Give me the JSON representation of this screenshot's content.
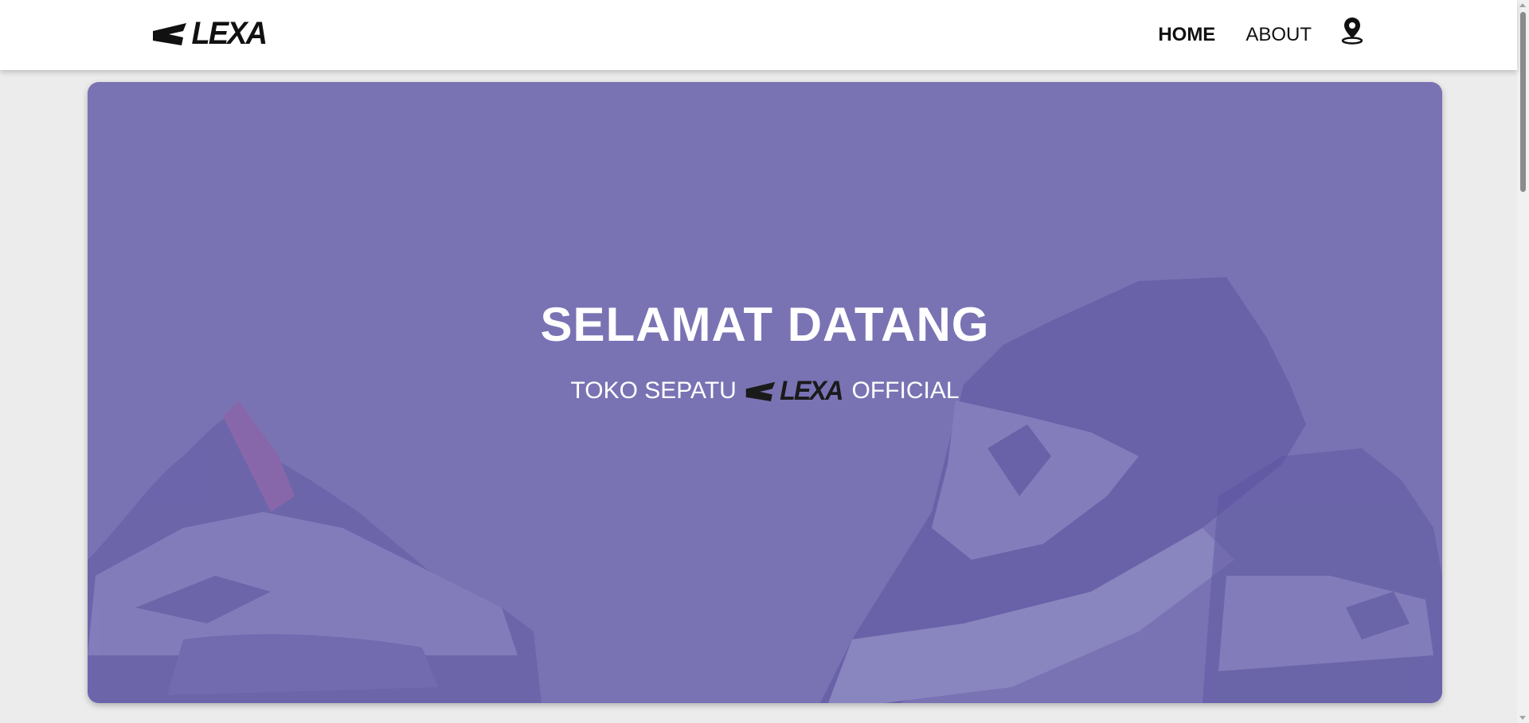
{
  "header": {
    "brand": "LEXA",
    "nav": [
      {
        "label": "HOME",
        "active": true
      },
      {
        "label": "ABOUT",
        "active": false
      }
    ],
    "location_icon": "map-pin-icon"
  },
  "hero": {
    "title": "SELAMAT DATANG",
    "subtitle_prefix": "TOKO SEPATU",
    "subtitle_brand": "LEXA",
    "subtitle_suffix": "OFFICIAL",
    "background_color": "#7973b4",
    "background_image": "sneakers-illustration"
  }
}
